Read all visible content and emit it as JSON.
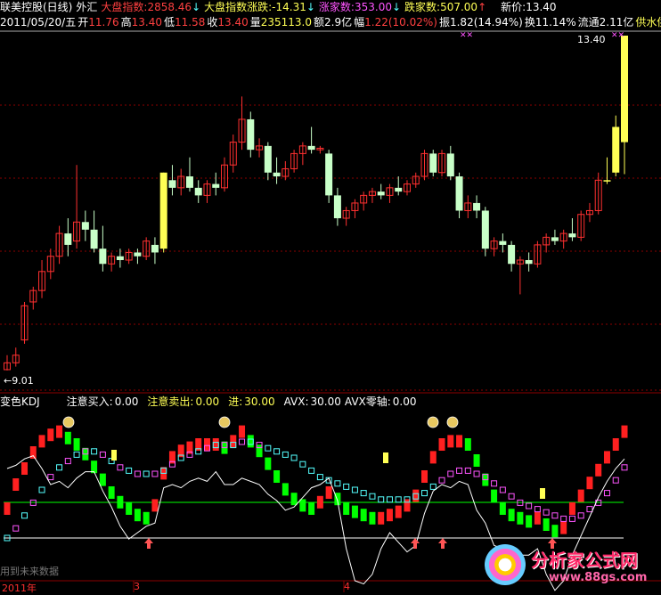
{
  "header": {
    "stock_name": "联美控股(日线)",
    "outer": "外汇",
    "index_label": "大盘指数:",
    "index_value": "2858.46",
    "index_arrow": "↓",
    "index_change_label": "大盘指数涨跌:",
    "index_change_value": "-14.31",
    "rise_label": "涨家数:",
    "rise_value": "353.00",
    "fall_label": "跌家数:",
    "fall_value": "507.00",
    "up_arrow": "↑",
    "newprice_label": "新价:",
    "newprice_value": "13.40"
  },
  "quote": {
    "date": "2011/05/20/五",
    "open_label": "开",
    "open": "11.76",
    "high_label": "高",
    "high": "13.40",
    "low_label": "低",
    "low": "11.58",
    "close_label": "收",
    "close": "13.40",
    "vol_label": "量",
    "vol": "235113.0",
    "amt_label": "额",
    "amt": "2.9亿",
    "chg_label": "幅",
    "chg": "1.22(10.02%)",
    "amp_label": "振",
    "amp": "1.82(14.94%)",
    "turn_label": "换",
    "turn": "11.14%",
    "float_label": "流通",
    "float": "2.11亿",
    "tag": "供水供"
  },
  "price_tags": {
    "high_tag": "13.40",
    "low_tag": "←9.01"
  },
  "kdj": {
    "name": "变色KDJ",
    "buy_label": "注意买入:",
    "buy_value": "0.00",
    "sell_label": "注意卖出:",
    "sell_value": "0.00",
    "in_label": "进:",
    "in_value": "30.00",
    "avx_label": "AVX:",
    "avx_value": "30.00",
    "avx0_label": "AVX零轴:",
    "avx0_value": "0.00"
  },
  "watermark_text": "用到未来数据",
  "xaxis": {
    "year": "2011年",
    "m3": "3",
    "m4": "4"
  },
  "logo_text": "分析家公式网",
  "logo_url": "www.88gs.com",
  "colors": {
    "up": "#ff2020",
    "down": "#00ff00",
    "yellow": "#ffff55",
    "candle_up": "#ff3030",
    "candle_down": "#c8ffc8",
    "grid": "#8b0000",
    "cyan": "#55ffff",
    "magenta": "#ff55ff",
    "white": "#ffffff"
  },
  "chart_data": {
    "type": "candlestick",
    "price_range": [
      9.01,
      13.4
    ],
    "candles": [
      {
        "o": 9.01,
        "h": 9.2,
        "l": 9.0,
        "c": 9.1,
        "t": "up"
      },
      {
        "o": 9.1,
        "h": 9.3,
        "l": 9.05,
        "c": 9.2,
        "t": "up"
      },
      {
        "o": 9.4,
        "h": 9.9,
        "l": 9.35,
        "c": 9.85,
        "t": "up"
      },
      {
        "o": 9.9,
        "h": 10.1,
        "l": 9.8,
        "c": 10.05,
        "t": "up"
      },
      {
        "o": 10.05,
        "h": 10.45,
        "l": 9.95,
        "c": 10.3,
        "t": "up"
      },
      {
        "o": 10.3,
        "h": 10.6,
        "l": 10.2,
        "c": 10.5,
        "t": "up"
      },
      {
        "o": 10.5,
        "h": 10.9,
        "l": 10.4,
        "c": 10.8,
        "t": "up"
      },
      {
        "o": 10.8,
        "h": 11.0,
        "l": 10.5,
        "c": 10.65,
        "t": "down"
      },
      {
        "o": 10.7,
        "h": 11.7,
        "l": 10.6,
        "c": 10.95,
        "t": "up"
      },
      {
        "o": 10.95,
        "h": 11.1,
        "l": 10.7,
        "c": 10.85,
        "t": "down"
      },
      {
        "o": 10.85,
        "h": 11.1,
        "l": 10.55,
        "c": 10.6,
        "t": "down"
      },
      {
        "o": 10.6,
        "h": 10.9,
        "l": 10.3,
        "c": 10.4,
        "t": "down"
      },
      {
        "o": 10.4,
        "h": 10.55,
        "l": 10.3,
        "c": 10.5,
        "t": "up"
      },
      {
        "o": 10.5,
        "h": 10.6,
        "l": 10.35,
        "c": 10.45,
        "t": "down"
      },
      {
        "o": 10.45,
        "h": 10.6,
        "l": 10.4,
        "c": 10.55,
        "t": "up"
      },
      {
        "o": 10.55,
        "h": 10.6,
        "l": 10.4,
        "c": 10.5,
        "t": "down"
      },
      {
        "o": 10.5,
        "h": 10.75,
        "l": 10.45,
        "c": 10.7,
        "t": "up"
      },
      {
        "o": 10.65,
        "h": 10.75,
        "l": 10.4,
        "c": 10.55,
        "t": "down"
      },
      {
        "o": 10.6,
        "h": 11.6,
        "l": 10.55,
        "c": 11.6,
        "t": "yellow"
      },
      {
        "o": 11.5,
        "h": 11.7,
        "l": 11.3,
        "c": 11.4,
        "t": "down"
      },
      {
        "o": 11.4,
        "h": 11.65,
        "l": 11.3,
        "c": 11.55,
        "t": "up"
      },
      {
        "o": 11.55,
        "h": 11.8,
        "l": 11.35,
        "c": 11.4,
        "t": "down"
      },
      {
        "o": 11.4,
        "h": 11.5,
        "l": 11.2,
        "c": 11.3,
        "t": "down"
      },
      {
        "o": 11.3,
        "h": 11.5,
        "l": 11.2,
        "c": 11.45,
        "t": "up"
      },
      {
        "o": 11.45,
        "h": 11.6,
        "l": 11.3,
        "c": 11.4,
        "t": "down"
      },
      {
        "o": 11.4,
        "h": 11.8,
        "l": 11.35,
        "c": 11.7,
        "t": "up"
      },
      {
        "o": 11.7,
        "h": 12.1,
        "l": 11.6,
        "c": 12.0,
        "t": "up"
      },
      {
        "o": 12.0,
        "h": 12.6,
        "l": 11.9,
        "c": 12.3,
        "t": "up"
      },
      {
        "o": 12.3,
        "h": 12.4,
        "l": 11.8,
        "c": 11.9,
        "t": "down"
      },
      {
        "o": 11.9,
        "h": 12.05,
        "l": 11.8,
        "c": 11.95,
        "t": "up"
      },
      {
        "o": 11.95,
        "h": 12.0,
        "l": 11.5,
        "c": 11.6,
        "t": "down"
      },
      {
        "o": 11.6,
        "h": 11.8,
        "l": 11.45,
        "c": 11.55,
        "t": "down"
      },
      {
        "o": 11.55,
        "h": 11.75,
        "l": 11.5,
        "c": 11.65,
        "t": "up"
      },
      {
        "o": 11.65,
        "h": 11.9,
        "l": 11.6,
        "c": 11.85,
        "t": "up"
      },
      {
        "o": 11.85,
        "h": 12.0,
        "l": 11.7,
        "c": 11.95,
        "t": "up"
      },
      {
        "o": 11.95,
        "h": 12.2,
        "l": 11.85,
        "c": 11.9,
        "t": "down"
      },
      {
        "o": 11.9,
        "h": 11.95,
        "l": 11.85,
        "c": 11.92,
        "t": "up"
      },
      {
        "o": 11.85,
        "h": 11.9,
        "l": 11.2,
        "c": 11.3,
        "t": "down"
      },
      {
        "o": 11.3,
        "h": 11.4,
        "l": 10.9,
        "c": 11.0,
        "t": "down"
      },
      {
        "o": 11.0,
        "h": 11.15,
        "l": 10.9,
        "c": 11.1,
        "t": "up"
      },
      {
        "o": 11.1,
        "h": 11.25,
        "l": 11.0,
        "c": 11.2,
        "t": "up"
      },
      {
        "o": 11.2,
        "h": 11.35,
        "l": 11.1,
        "c": 11.3,
        "t": "up"
      },
      {
        "o": 11.3,
        "h": 11.4,
        "l": 11.2,
        "c": 11.35,
        "t": "up"
      },
      {
        "o": 11.35,
        "h": 11.45,
        "l": 11.25,
        "c": 11.3,
        "t": "down"
      },
      {
        "o": 11.3,
        "h": 11.45,
        "l": 11.2,
        "c": 11.4,
        "t": "up"
      },
      {
        "o": 11.4,
        "h": 11.55,
        "l": 11.3,
        "c": 11.35,
        "t": "down"
      },
      {
        "o": 11.35,
        "h": 11.5,
        "l": 11.3,
        "c": 11.45,
        "t": "up"
      },
      {
        "o": 11.45,
        "h": 11.6,
        "l": 11.4,
        "c": 11.55,
        "t": "up"
      },
      {
        "o": 11.55,
        "h": 11.9,
        "l": 11.5,
        "c": 11.85,
        "t": "up"
      },
      {
        "o": 11.85,
        "h": 11.9,
        "l": 11.55,
        "c": 11.6,
        "t": "down"
      },
      {
        "o": 11.6,
        "h": 11.9,
        "l": 11.55,
        "c": 11.85,
        "t": "up"
      },
      {
        "o": 11.85,
        "h": 11.95,
        "l": 11.5,
        "c": 11.55,
        "t": "down"
      },
      {
        "o": 11.55,
        "h": 11.6,
        "l": 11.0,
        "c": 11.1,
        "t": "down"
      },
      {
        "o": 11.1,
        "h": 11.3,
        "l": 11.0,
        "c": 11.2,
        "t": "up"
      },
      {
        "o": 11.2,
        "h": 11.3,
        "l": 11.0,
        "c": 11.1,
        "t": "down"
      },
      {
        "o": 11.1,
        "h": 11.15,
        "l": 10.5,
        "c": 10.6,
        "t": "down"
      },
      {
        "o": 10.6,
        "h": 10.75,
        "l": 10.5,
        "c": 10.7,
        "t": "up"
      },
      {
        "o": 10.7,
        "h": 10.8,
        "l": 10.55,
        "c": 10.65,
        "t": "down"
      },
      {
        "o": 10.65,
        "h": 10.7,
        "l": 10.3,
        "c": 10.4,
        "t": "down"
      },
      {
        "o": 10.4,
        "h": 10.5,
        "l": 10.0,
        "c": 10.45,
        "t": "up"
      },
      {
        "o": 10.45,
        "h": 10.55,
        "l": 10.3,
        "c": 10.4,
        "t": "down"
      },
      {
        "o": 10.4,
        "h": 10.7,
        "l": 10.35,
        "c": 10.65,
        "t": "up"
      },
      {
        "o": 10.65,
        "h": 10.8,
        "l": 10.55,
        "c": 10.75,
        "t": "up"
      },
      {
        "o": 10.75,
        "h": 10.85,
        "l": 10.65,
        "c": 10.7,
        "t": "down"
      },
      {
        "o": 10.7,
        "h": 10.85,
        "l": 10.6,
        "c": 10.8,
        "t": "up"
      },
      {
        "o": 10.8,
        "h": 11.0,
        "l": 10.7,
        "c": 10.75,
        "t": "down"
      },
      {
        "o": 10.75,
        "h": 11.1,
        "l": 10.7,
        "c": 11.05,
        "t": "up"
      },
      {
        "o": 11.05,
        "h": 11.2,
        "l": 10.95,
        "c": 11.1,
        "t": "up"
      },
      {
        "o": 11.1,
        "h": 11.6,
        "l": 11.05,
        "c": 11.5,
        "t": "up"
      },
      {
        "o": 11.5,
        "h": 11.8,
        "l": 11.45,
        "c": 11.5,
        "t": "yellow"
      },
      {
        "o": 11.6,
        "h": 12.35,
        "l": 11.55,
        "c": 12.2,
        "t": "yellow"
      },
      {
        "o": 12.0,
        "h": 13.4,
        "l": 11.58,
        "c": 13.4,
        "t": "yellow"
      }
    ]
  }
}
